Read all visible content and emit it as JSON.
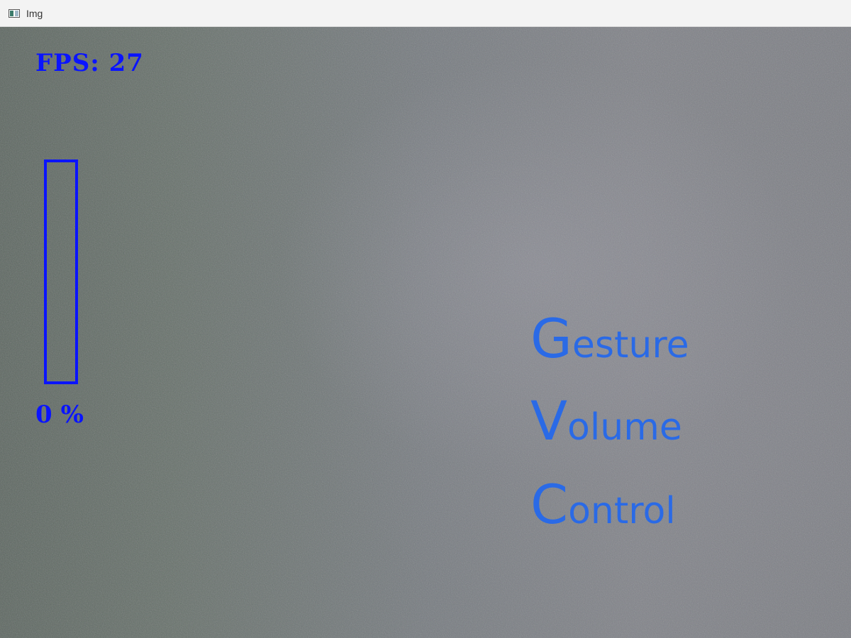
{
  "window": {
    "title": "Img",
    "icon": "image-window-icon"
  },
  "hud": {
    "fps_label": "FPS: 27",
    "volume_percent": 0,
    "volume_unit": "%",
    "color": "#0a14ff"
  },
  "overlay": {
    "color": "#2a6ae6",
    "lines": [
      {
        "cap": "G",
        "rest": "esture"
      },
      {
        "cap": "V",
        "rest": "olume"
      },
      {
        "cap": "C",
        "rest": "ontrol"
      }
    ]
  }
}
